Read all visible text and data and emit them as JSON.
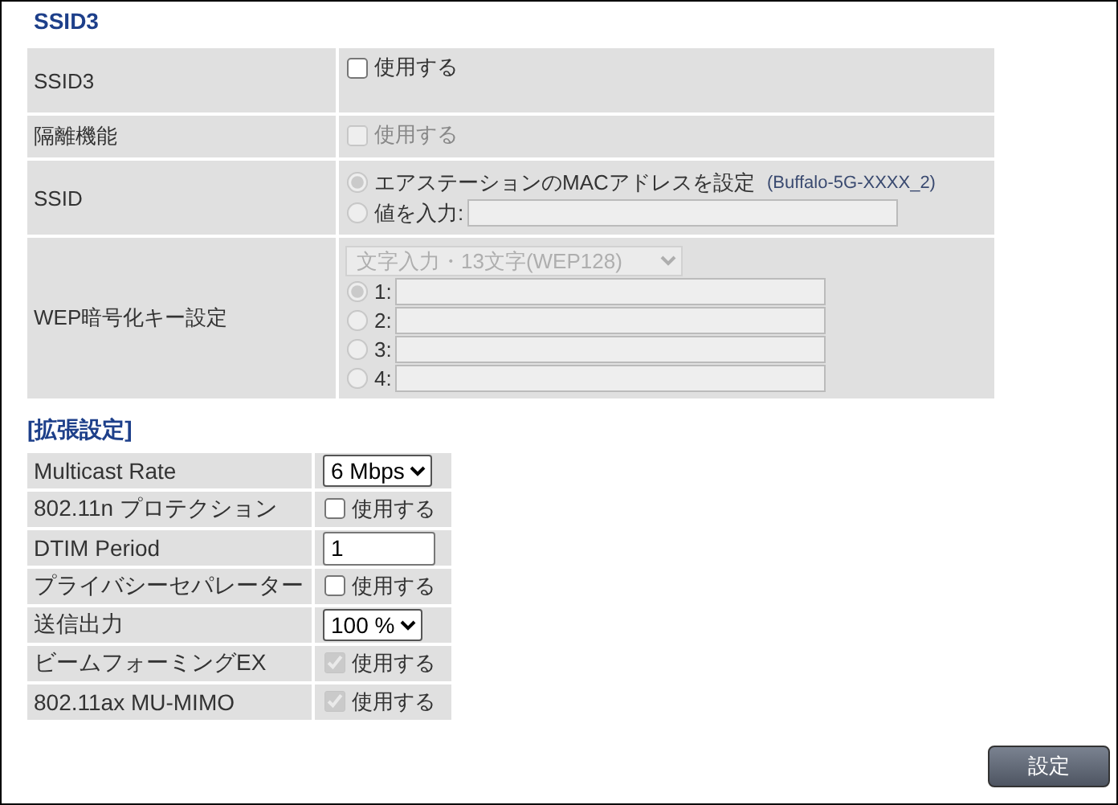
{
  "section_title": "SSID3",
  "basic_rows": [
    {
      "kind": "checkbox",
      "label": "SSID3",
      "option": "使用する",
      "checked": false,
      "disabled": false
    },
    {
      "kind": "checkbox",
      "label": "隔離機能",
      "option": "使用する",
      "checked": false,
      "disabled": true
    },
    {
      "kind": "radios",
      "label": "SSID",
      "options": [
        {
          "label": "エアステーションのMACアドレスを設定",
          "note": "(Buffalo-5G-XXXX_2)",
          "selected": true,
          "has_field": false,
          "disabled": true
        },
        {
          "label": "値を入力:",
          "selected": false,
          "has_field": true,
          "disabled": true
        }
      ]
    },
    {
      "kind": "wep",
      "label": "WEP暗号化キー設定",
      "select": "文字入力・13文字(WEP128)",
      "disabled": true,
      "keys": [
        {
          "label": "1:",
          "selected": true
        },
        {
          "label": "2:",
          "selected": false
        },
        {
          "label": "3:",
          "selected": false
        },
        {
          "label": "4:",
          "selected": false
        }
      ]
    }
  ],
  "extended_title": "[拡張設定]",
  "extended_rows": [
    {
      "kind": "select",
      "label": "Multicast Rate",
      "value": "6 Mbps"
    },
    {
      "kind": "checkbox",
      "label": "802.11n プロテクション",
      "option": "使用する",
      "checked": false,
      "disabled": false
    },
    {
      "kind": "input",
      "label": "DTIM Period",
      "value": "1"
    },
    {
      "kind": "checkbox",
      "label": "プライバシーセパレーター",
      "option": "使用する",
      "checked": false,
      "disabled": false
    },
    {
      "kind": "select",
      "label": "送信出力",
      "value": "100 %"
    },
    {
      "kind": "checkbox",
      "label": "ビームフォーミングEX",
      "option": "使用する",
      "checked": true,
      "disabled": true
    },
    {
      "kind": "checkbox",
      "label": "802.11ax MU-MIMO",
      "option": "使用する",
      "checked": true,
      "disabled": true
    }
  ],
  "submit": "設定"
}
